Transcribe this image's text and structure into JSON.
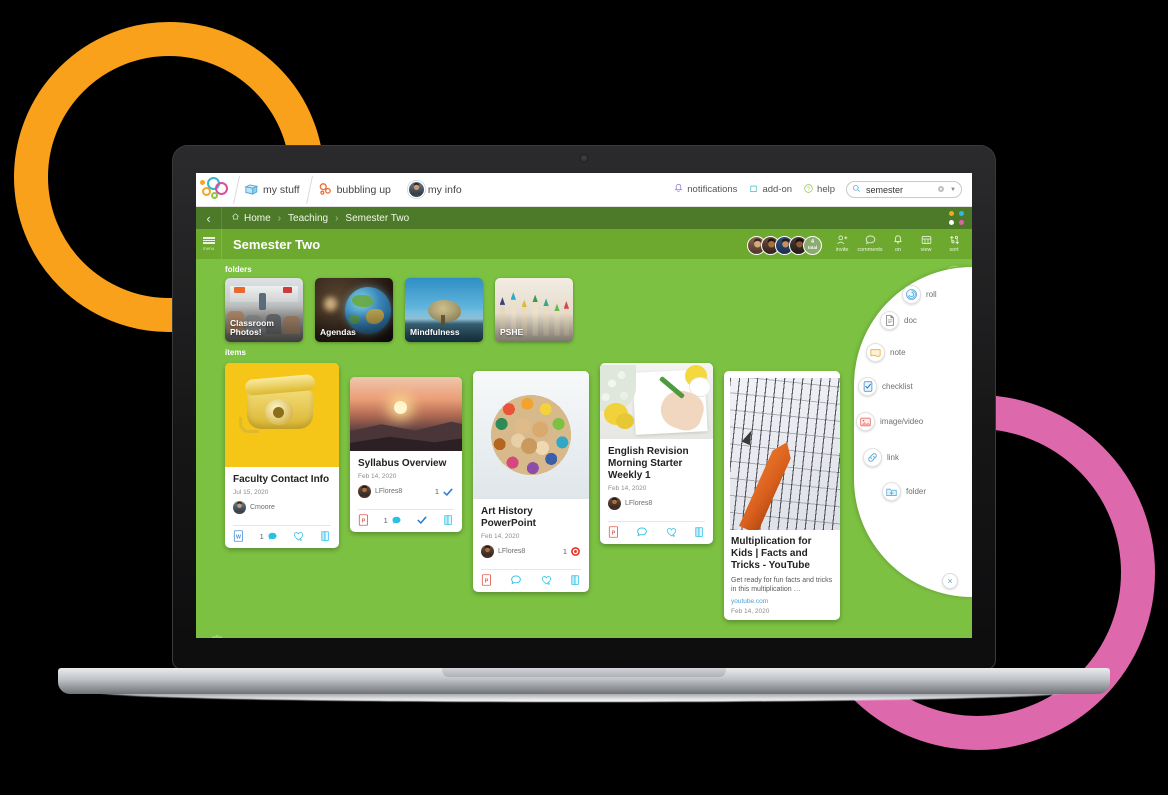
{
  "brand": {
    "logo_name": "seesaw-logo",
    "colors": {
      "green_body": "#7cc142",
      "green_title": "#6da92e",
      "green_crumb": "#4d7a29",
      "orange_ring": "#f9a11b",
      "pink_ring": "#dd68ab",
      "accent_blue": "#29a3dc"
    }
  },
  "topbar": {
    "tabs": [
      {
        "label": "my stuff",
        "icon": "folder-icon",
        "selected": true
      },
      {
        "label": "bubbling up",
        "icon": "bubbles-icon",
        "selected": false
      },
      {
        "label": "my info",
        "icon": "avatar-icon",
        "selected": false
      }
    ],
    "right_items": [
      {
        "label": "notifications",
        "icon": "bell-icon"
      },
      {
        "label": "add-on",
        "icon": "puzzle-icon"
      },
      {
        "label": "help",
        "icon": "question-icon"
      }
    ],
    "search": {
      "value": "semester",
      "placeholder": "search",
      "icon": "search-icon",
      "clear_icon": "clear-icon",
      "filter_icon": "chevron-down-icon"
    }
  },
  "breadcrumb": {
    "back_icon": "chevron-left-icon",
    "items": [
      {
        "label": "Home",
        "icon": "home-icon"
      },
      {
        "label": "Teaching",
        "icon": ""
      },
      {
        "label": "Semester Two",
        "icon": ""
      }
    ],
    "separator": "›",
    "dots": [
      "#f5a623",
      "#2fb8e6",
      "#ffffff",
      "#e05fa8"
    ]
  },
  "titlebar": {
    "menu_label": "menu",
    "title": "Semester Two",
    "avatars": [
      {
        "name": "member-1"
      },
      {
        "name": "member-2"
      },
      {
        "name": "member-3"
      },
      {
        "name": "member-4"
      }
    ],
    "avatar_count": "4",
    "avatar_count_label": "total",
    "actions": [
      {
        "label": "invite",
        "icon": "add-person-icon"
      },
      {
        "label": "comments",
        "icon": "comment-icon"
      },
      {
        "label": "on",
        "icon": "bell-icon"
      },
      {
        "label": "view",
        "icon": "grid-view-icon"
      },
      {
        "label": "sort",
        "icon": "sort-icon"
      }
    ]
  },
  "board": {
    "folders_label": "folders",
    "items_label": "items",
    "favorite_icon": "star-icon",
    "trash_icon": "trash-icon",
    "folders": [
      {
        "name": "Classroom Photos!",
        "thumb": "classroom-photo"
      },
      {
        "name": "Agendas",
        "thumb": "globe-photo"
      },
      {
        "name": "Mindfulness",
        "thumb": "tree-photo"
      },
      {
        "name": "PSHE",
        "thumb": "pencils-photo"
      }
    ],
    "items": [
      {
        "title": "Faculty Contact Info",
        "date": "Jul 15, 2020",
        "owner": "Cmoore",
        "thumb": "yellow-telephone-photo",
        "file_icon": "word-doc-icon",
        "comments": "1",
        "like_icon": "heart-plus-icon",
        "read_icon": "book-icon",
        "check_count": "",
        "badge": ""
      },
      {
        "title": "Syllabus Overview",
        "date": "Feb 14, 2020",
        "owner": "LFlores8",
        "thumb": "sunset-photo",
        "file_icon": "powerpoint-icon",
        "comments": "1",
        "like_icon": "check-icon",
        "read_icon": "book-icon",
        "check_count": "1",
        "badge": "check-icon"
      },
      {
        "title": "Art History PowerPoint",
        "date": "Feb 14, 2020",
        "owner": "LFlores8",
        "thumb": "colored-pencils-photo",
        "file_icon": "powerpoint-icon",
        "comments": "",
        "like_icon": "heart-plus-icon",
        "read_icon": "book-icon",
        "check_count": "1",
        "badge": "target-icon"
      },
      {
        "title": "English Revision Morning Starter Weekly 1",
        "date": "Feb 14, 2020",
        "owner": "LFlores8",
        "thumb": "desk-writing-photo",
        "file_icon": "powerpoint-icon",
        "comments": "",
        "like_icon": "heart-plus-icon",
        "read_icon": "book-icon",
        "check_count": "",
        "badge": ""
      }
    ],
    "link_item": {
      "title": "Multiplication for Kids | Facts and Tricks - YouTube",
      "description": "Get ready for fun facts and tricks in this multiplication …",
      "source": "youtube.com",
      "date": "Feb 14, 2020",
      "thumb": "math-worksheet-photo"
    }
  },
  "fab": {
    "items": [
      {
        "label": "roll",
        "icon": "roll-icon"
      },
      {
        "label": "doc",
        "icon": "doc-icon"
      },
      {
        "label": "note",
        "icon": "note-icon"
      },
      {
        "label": "checklist",
        "icon": "checklist-icon"
      },
      {
        "label": "image/video",
        "icon": "image-video-icon"
      },
      {
        "label": "link",
        "icon": "link-icon"
      },
      {
        "label": "folder",
        "icon": "folder-plus-icon"
      }
    ],
    "close_icon": "close-icon",
    "close_label": "×"
  }
}
